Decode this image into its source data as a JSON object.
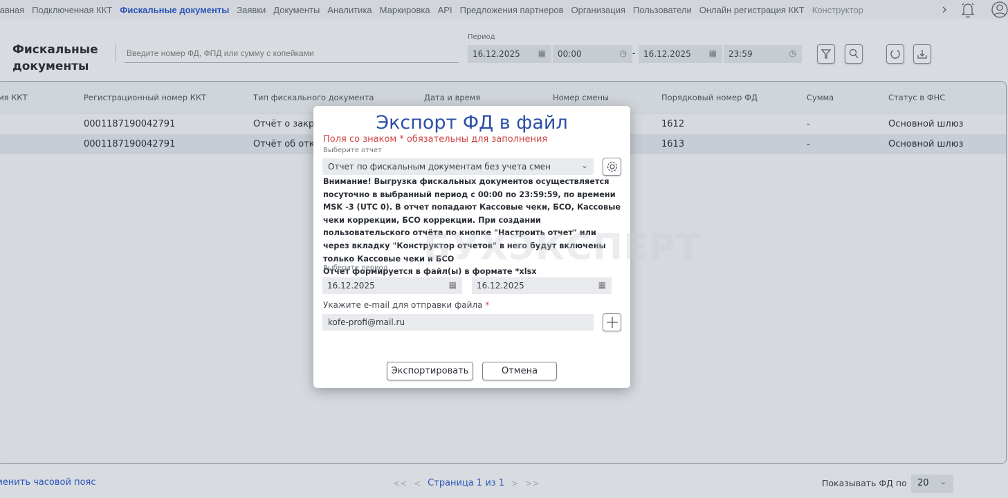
{
  "nav": {
    "items": [
      {
        "label": "лавная",
        "active": false
      },
      {
        "label": "Подключенная ККТ",
        "active": false
      },
      {
        "label": "Фискальные документы",
        "active": true
      },
      {
        "label": "Заявки",
        "active": false
      },
      {
        "label": "Документы",
        "active": false
      },
      {
        "label": "Аналитика",
        "active": false
      },
      {
        "label": "Маркировка",
        "active": false
      },
      {
        "label": "API",
        "active": false
      },
      {
        "label": "Предложения партнеров",
        "active": false
      },
      {
        "label": "Организация",
        "active": false
      },
      {
        "label": "Пользователи",
        "active": false
      },
      {
        "label": "Онлайн регистрация ККТ",
        "active": false
      },
      {
        "label": "Конструктор",
        "active": false
      }
    ],
    "more_icon": "chevron-right-icon",
    "bell_icon": "bell-icon",
    "user_icon": "user-icon"
  },
  "page": {
    "title_line1": "Фискальные",
    "title_line2": "документы",
    "search_placeholder": "Введите номер ФД, ФПД или сумму с копейками",
    "period_label": "Период",
    "date_from": "16.12.2025",
    "time_from": "00:00",
    "date_to": "16.12.2025",
    "time_to": "23:59",
    "dash": "-"
  },
  "table": {
    "columns": [
      "мя ККТ",
      "Регистрационный номер ККТ",
      "Тип фискального документа",
      "Дата и время",
      "Номер смены",
      "Порядковый номер ФД",
      "Сумма",
      "Статус в ФНС"
    ],
    "rows": [
      {
        "reg": "0001187190042791",
        "type": "Отчёт о закры",
        "fd": "1612",
        "sum": "-",
        "status": "Основной шлюз"
      },
      {
        "reg": "0001187190042791",
        "type": "Отчёт об откр",
        "fd": "1613",
        "sum": "-",
        "status": "Основной шлюз"
      }
    ]
  },
  "modal": {
    "title": "Экспорт ФД в файл",
    "required_note": "Поля со знаком * обязательны для заполнения",
    "report_label": "Выберите отчет",
    "report_value": "Отчет по фискальным документам без учета смен",
    "warning": "Внимание! Выгрузка фискальных документов осуществляется посуточно в выбранный период с 00:00 по 23:59:59, по времени MSK -3 (UTC 0). В отчет попадают Кассовые чеки, БСО, Кассовые чеки коррекции, БСО коррекции. При создании пользовательского отчёта по кнопке \"Настроить отчет\" или через вкладку \"Конструктор отчетов\" в него будут включены только Кассовые чеки и БСО",
    "format_note": "Отчет формируется в файл(ы) в формате *xlsx",
    "period_label": "Выберите период",
    "date_from": "16.12.2025",
    "date_to": "16.12.2025",
    "email_label": "Укажите e-mail для отправки файла",
    "required_star": "*",
    "email_value": "kofe-profi@mail.ru",
    "export_button": "Экспортировать",
    "cancel_button": "Отмена"
  },
  "watermark": "БУХЭКСПЕРТ",
  "footer": {
    "timezone_link": "менить часовой пояс",
    "first": "<<",
    "prev": "<",
    "page_text": "Страница 1 из 1",
    "next": ">",
    "last": ">>",
    "show_label": "Показывать ФД по",
    "page_size": "20"
  },
  "colors": {
    "accent": "#2b54b8",
    "required": "#d04848",
    "modal_title": "#2b4ea6"
  }
}
